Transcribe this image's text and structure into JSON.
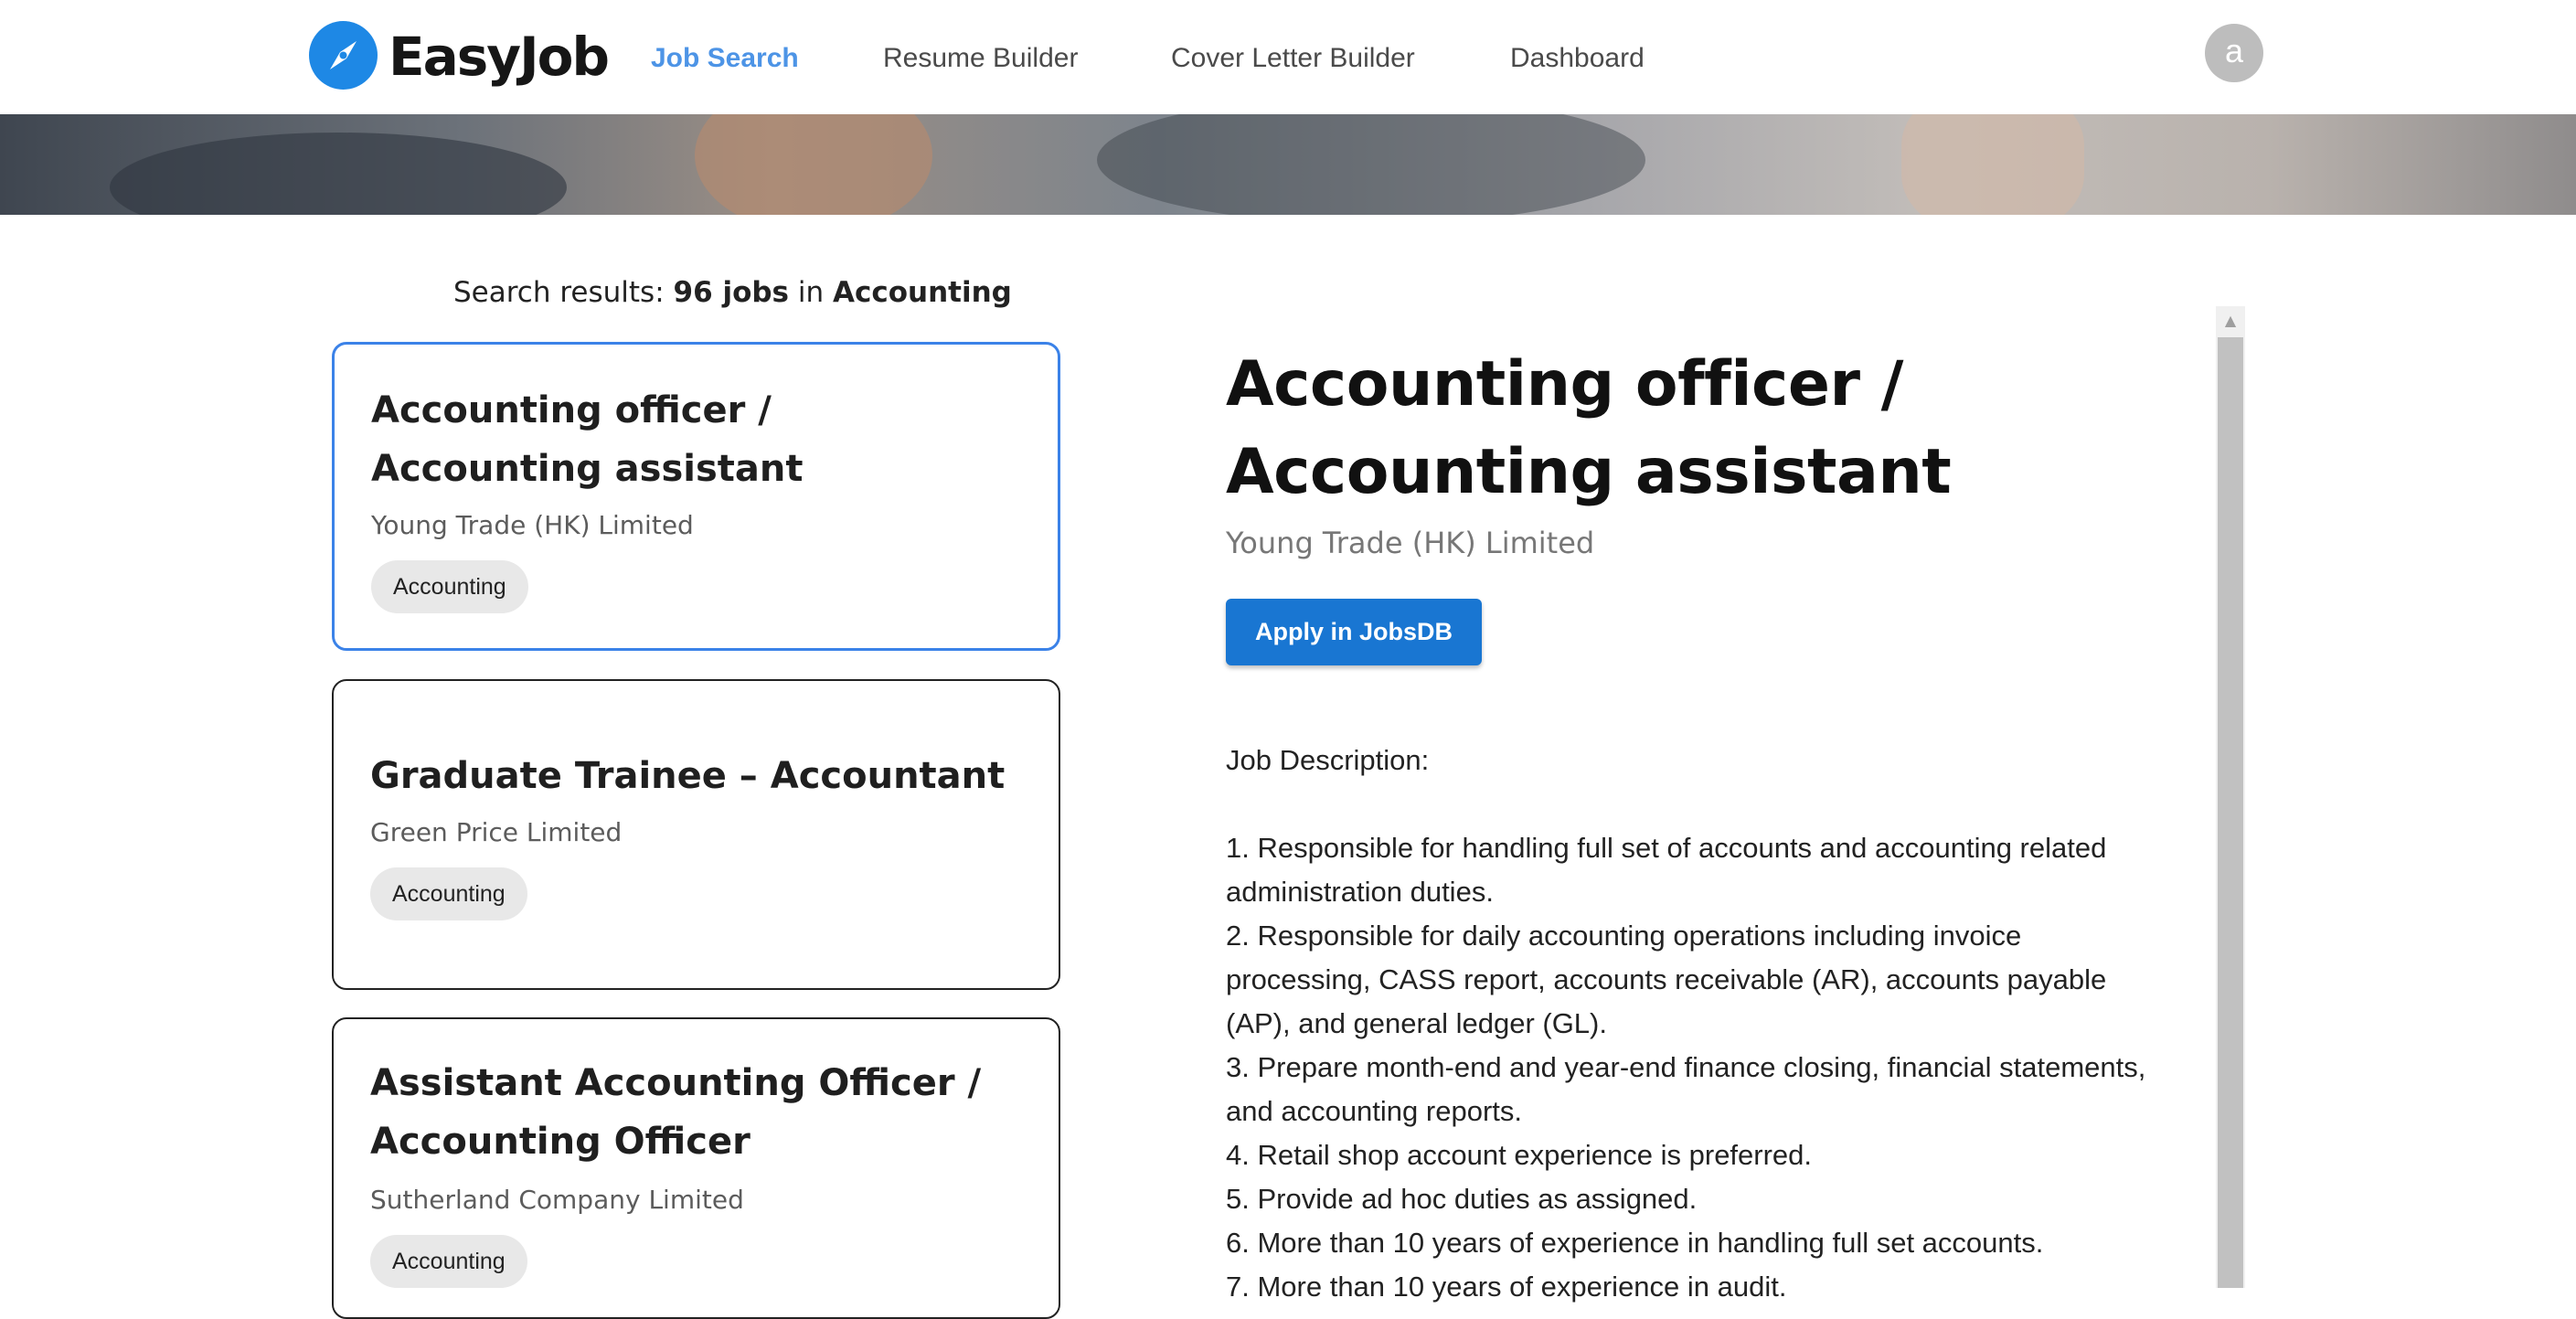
{
  "nav": {
    "brand": "EasyJob",
    "links": [
      "Job Search",
      "Resume Builder",
      "Cover Letter Builder",
      "Dashboard"
    ],
    "active_link": "Job Search",
    "avatar_initial": "a"
  },
  "results": {
    "prefix": "Search results: ",
    "count": "96 jobs",
    "connector": " in ",
    "category": "Accounting"
  },
  "jobs": [
    {
      "title": "Accounting officer / Accounting assistant",
      "company": "Young Trade (HK) Limited",
      "tag": "Accounting",
      "selected": true
    },
    {
      "title": "Graduate Trainee – Accountant",
      "company": "Green Price Limited",
      "tag": "Accounting",
      "selected": false
    },
    {
      "title": "Assistant Accounting Officer / Accounting Officer",
      "company": "Sutherland Company Limited",
      "tag": "Accounting",
      "selected": false
    }
  ],
  "detail": {
    "title": "Accounting officer / Accounting assistant",
    "company": "Young Trade (HK) Limited",
    "apply_label": "Apply in JobsDB",
    "description_heading": "Job Description:",
    "description_items": [
      "1. Responsible for handling full set of accounts and accounting related administration duties.",
      "2. Responsible for daily accounting operations including invoice processing, CASS report, accounts receivable (AR), accounts payable (AP), and general ledger (GL).",
      "3. Prepare month-end and year-end finance closing, financial statements, and accounting reports.",
      "4. Retail shop account experience is preferred.",
      "5. Provide ad hoc duties as assigned.",
      "6. More than 10 years of experience in handling full set accounts.",
      "7. More than 10 years of experience in audit."
    ]
  },
  "colors": {
    "brand": "#1e88e5",
    "nav_active": "#4d94e6",
    "apply_button": "#1976d2",
    "selected_card_border": "#3b82e8"
  }
}
